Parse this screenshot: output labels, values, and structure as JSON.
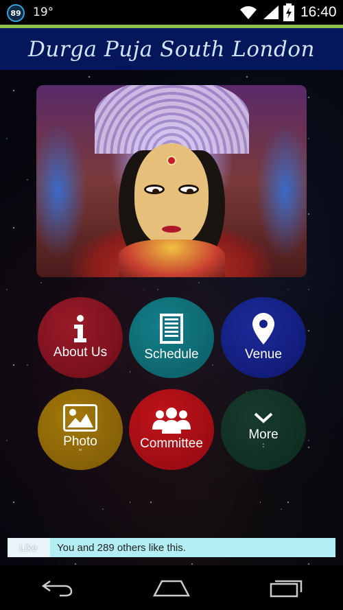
{
  "status_bar": {
    "notification_count": "89",
    "temperature": "19°",
    "time": "16:40",
    "icons": [
      "wifi-icon",
      "signal-icon",
      "battery-icon"
    ]
  },
  "app": {
    "title": "Durga Puja South London"
  },
  "hero_image": {
    "icon": "durga-idol-image"
  },
  "menu": {
    "about": {
      "label": "About Us",
      "icon": "info-icon",
      "color": "#8a1422"
    },
    "schedule": {
      "label": "Schedule",
      "icon": "document-icon",
      "color": "#117480"
    },
    "venue": {
      "label": "Venue",
      "icon": "location-pin-icon",
      "color": "#152186"
    },
    "photo": {
      "label": "Photo",
      "sub": "\"",
      "icon": "picture-icon",
      "color": "#926b08"
    },
    "committee": {
      "label": "Committee",
      "icon": "group-icon",
      "color": "#b01016"
    },
    "more": {
      "label": "More",
      "sub": ":",
      "icon": "chevron-down-icon",
      "color": "#123426"
    }
  },
  "like_bar": {
    "button_label": "Like",
    "text": "You and 289 others like this."
  },
  "nav_bar": {
    "icons": [
      "back-icon",
      "home-icon",
      "recent-apps-icon"
    ]
  },
  "colors": {
    "header_bg": "#06165a",
    "accent_line": "#8bc34a",
    "like_bar_bg": "#b2eef4"
  }
}
